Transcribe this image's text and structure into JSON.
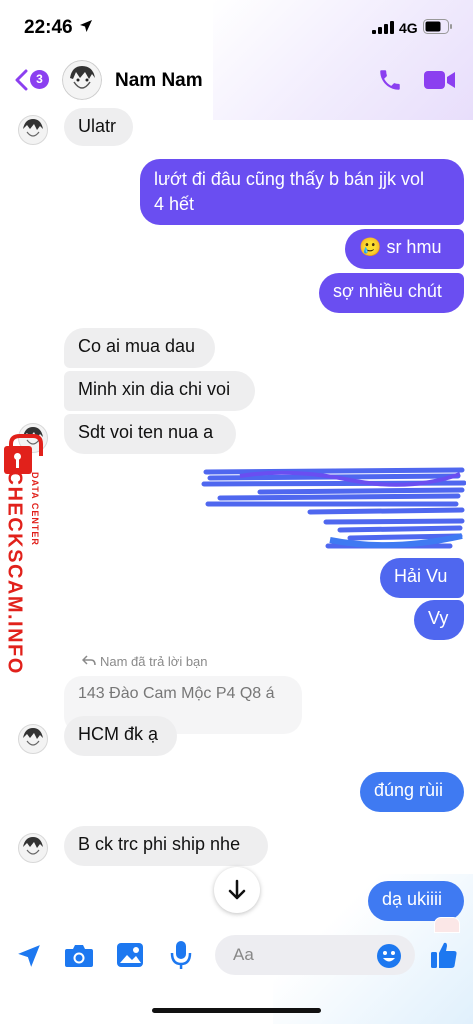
{
  "status_bar": {
    "time": "22:46",
    "network": "4G"
  },
  "header": {
    "unread_count": "3",
    "contact_name": "Nam Nam"
  },
  "messages": [
    {
      "dir": "in",
      "text": "Ulatr"
    },
    {
      "dir": "out",
      "lines": [
        "lướt đi đâu cũng thấy b bán jjk vol",
        "4 hết"
      ]
    },
    {
      "dir": "out",
      "emoji": "🥲",
      "text": "sr hmu"
    },
    {
      "dir": "out",
      "text": "sợ nhiều chút"
    },
    {
      "dir": "in",
      "text": "Co ai mua dau"
    },
    {
      "dir": "in",
      "text": "Minh xin dia chi voi"
    },
    {
      "dir": "in",
      "text": "Sdt voi ten nua a"
    },
    {
      "dir": "out",
      "text": "Hải Vu"
    },
    {
      "dir": "out",
      "text": "Vy"
    },
    {
      "dir": "in",
      "text": "HCM đk ạ"
    },
    {
      "dir": "out",
      "text": "đúng rùii"
    },
    {
      "dir": "in",
      "text": "B ck trc phi ship nhe"
    },
    {
      "dir": "out",
      "text": "dạ ukiiii"
    }
  ],
  "reply": {
    "info": "Nam đã trả lời bạn",
    "quoted": "143 Đào Cam Mộc P4 Q8 á"
  },
  "watermark": {
    "site": "CHECKSCAM.INFO",
    "label": "DATA CENTER"
  },
  "composer": {
    "placeholder": "Aa"
  },
  "icons": [
    "location-arrow-icon",
    "wifi-signal-icon",
    "battery-icon",
    "back-chevron-icon",
    "phone-icon",
    "video-camera-icon",
    "send-location-icon",
    "camera-icon",
    "gallery-icon",
    "microphone-icon",
    "emoji-icon",
    "thumbs-up-icon",
    "arrow-down-icon",
    "reply-icon",
    "lock-icon"
  ],
  "colors": {
    "accent": "#8b3ff0",
    "outgoing_top": "#6a4ef1",
    "outgoing_bottom": "#3f7af2",
    "incoming": "#eeeeef",
    "watermark": "#e1211b"
  }
}
